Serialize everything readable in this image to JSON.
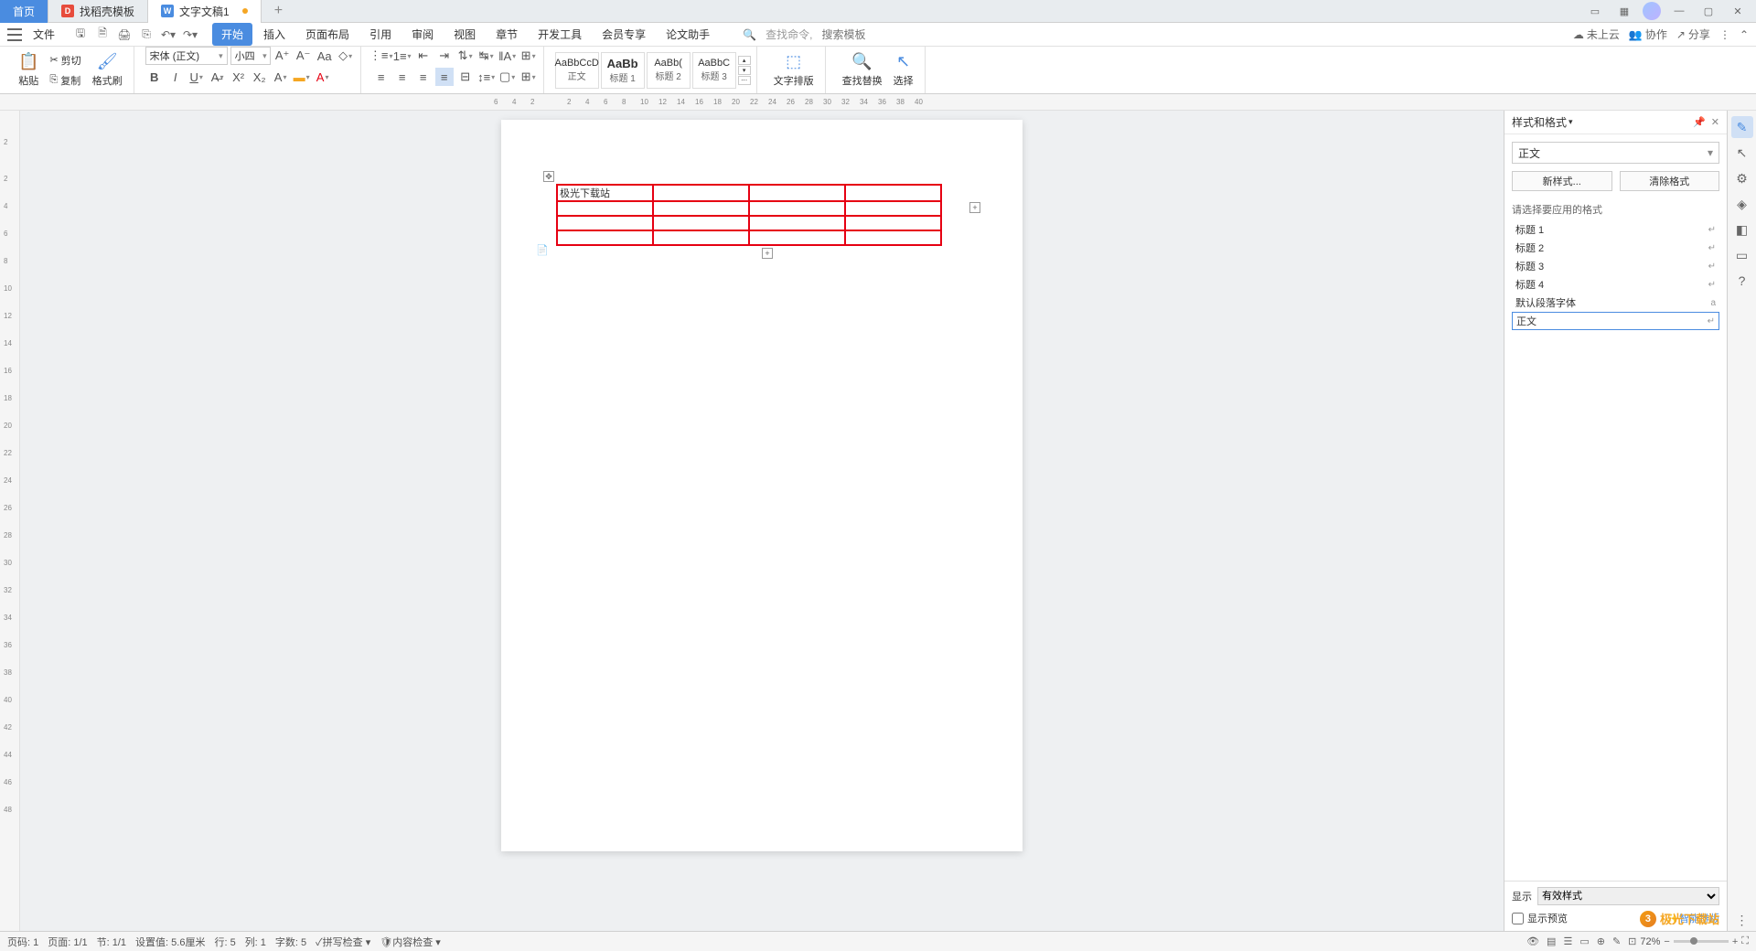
{
  "tabs": {
    "home": "首页",
    "template": "找稻壳模板",
    "doc": "文字文稿1"
  },
  "menubar": {
    "file": "文件",
    "tabs": [
      "开始",
      "插入",
      "页面布局",
      "引用",
      "审阅",
      "视图",
      "章节",
      "开发工具",
      "会员专享",
      "论文助手"
    ],
    "search_cmd": "查找命令,",
    "search_tpl": "搜索模板",
    "cloud": "未上云",
    "coop": "协作",
    "share": "分享"
  },
  "ribbon": {
    "paste": "粘贴",
    "cut": "剪切",
    "copy": "复制",
    "format_painter": "格式刷",
    "font_name": "宋体 (正文)",
    "font_size": "小四",
    "styles": {
      "body": {
        "preview": "AaBbCcD",
        "label": "正文"
      },
      "h1": {
        "preview": "AaBb",
        "label": "标题 1"
      },
      "h2": {
        "preview": "AaBb(",
        "label": "标题 2"
      },
      "h3": {
        "preview": "AaBbC",
        "label": "标题 3"
      }
    },
    "text_layout": "文字排版",
    "find_replace": "查找替换",
    "select": "选择"
  },
  "ruler_h": [
    "6",
    "4",
    "2",
    "2",
    "4",
    "6",
    "8",
    "10",
    "12",
    "14",
    "16",
    "18",
    "20",
    "22",
    "24",
    "26",
    "28",
    "30",
    "32",
    "34",
    "36",
    "38",
    "40"
  ],
  "ruler_v": [
    "2",
    "2",
    "4",
    "6",
    "8",
    "10",
    "12",
    "14",
    "16",
    "18",
    "20",
    "22",
    "24",
    "26",
    "28",
    "30",
    "32",
    "34",
    "36",
    "38",
    "40",
    "42",
    "44",
    "46",
    "48"
  ],
  "document": {
    "table_cell": "极光下载站"
  },
  "panel": {
    "title": "样式和格式",
    "current_style": "正文",
    "new_style": "新样式...",
    "clear_format": "清除格式",
    "apply_label": "请选择要应用的格式",
    "items": [
      {
        "name": "标题 1"
      },
      {
        "name": "标题 2"
      },
      {
        "name": "标题 3"
      },
      {
        "name": "标题 4"
      },
      {
        "name": "默认段落字体"
      },
      {
        "name": "正文"
      }
    ],
    "display_label": "显示",
    "display_value": "有效样式",
    "preview_label": "显示预览",
    "smart": "智能排版"
  },
  "statusbar": {
    "page_no": "页码: 1",
    "page": "页面: 1/1",
    "section": "节: 1/1",
    "pos": "设置值: 5.6厘米",
    "line": "行: 5",
    "col": "列: 1",
    "words": "字数: 5",
    "spell": "拼写检查",
    "content": "内容检查",
    "zoom": "72%"
  },
  "watermark": "极光下载站"
}
